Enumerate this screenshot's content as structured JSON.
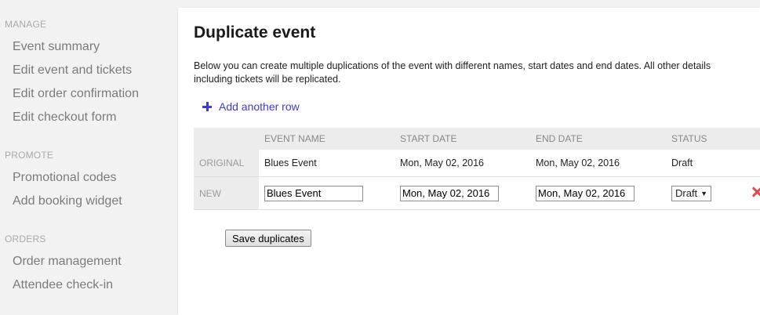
{
  "sidebar": {
    "sections": [
      {
        "label": "MANAGE",
        "items": [
          "Event summary",
          "Edit event and tickets",
          "Edit order confirmation",
          "Edit checkout form"
        ]
      },
      {
        "label": "PROMOTE",
        "items": [
          "Promotional codes",
          "Add booking widget"
        ]
      },
      {
        "label": "ORDERS",
        "items": [
          "Order management",
          "Attendee check-in"
        ]
      }
    ]
  },
  "main": {
    "title": "Duplicate event",
    "description": "Below you can create multiple duplications of the event with different names, start dates and end dates. All other details including tickets will be replicated.",
    "add_row_label": "Add another row",
    "table": {
      "headers": [
        "",
        "EVENT NAME",
        "START DATE",
        "END DATE",
        "STATUS"
      ],
      "original": {
        "label": "ORIGINAL",
        "event_name": "Blues Event",
        "start_date": "Mon, May 02, 2016",
        "end_date": "Mon, May 02, 2016",
        "status": "Draft"
      },
      "new": {
        "label": "NEW",
        "event_name": "Blues Event",
        "start_date": "Mon, May 02, 2016",
        "end_date": "Mon, May 02, 2016",
        "status": "Draft"
      }
    },
    "save_label": "Save duplicates"
  },
  "colors": {
    "accent": "#3b3bd6",
    "delete": "#e04b4b",
    "sidebar_bg": "#f2f2f2",
    "panel_bg": "#ffffff"
  },
  "icons": {
    "add": "plus-icon",
    "remove": "close-icon",
    "dropdown": "caret-down-icon"
  }
}
